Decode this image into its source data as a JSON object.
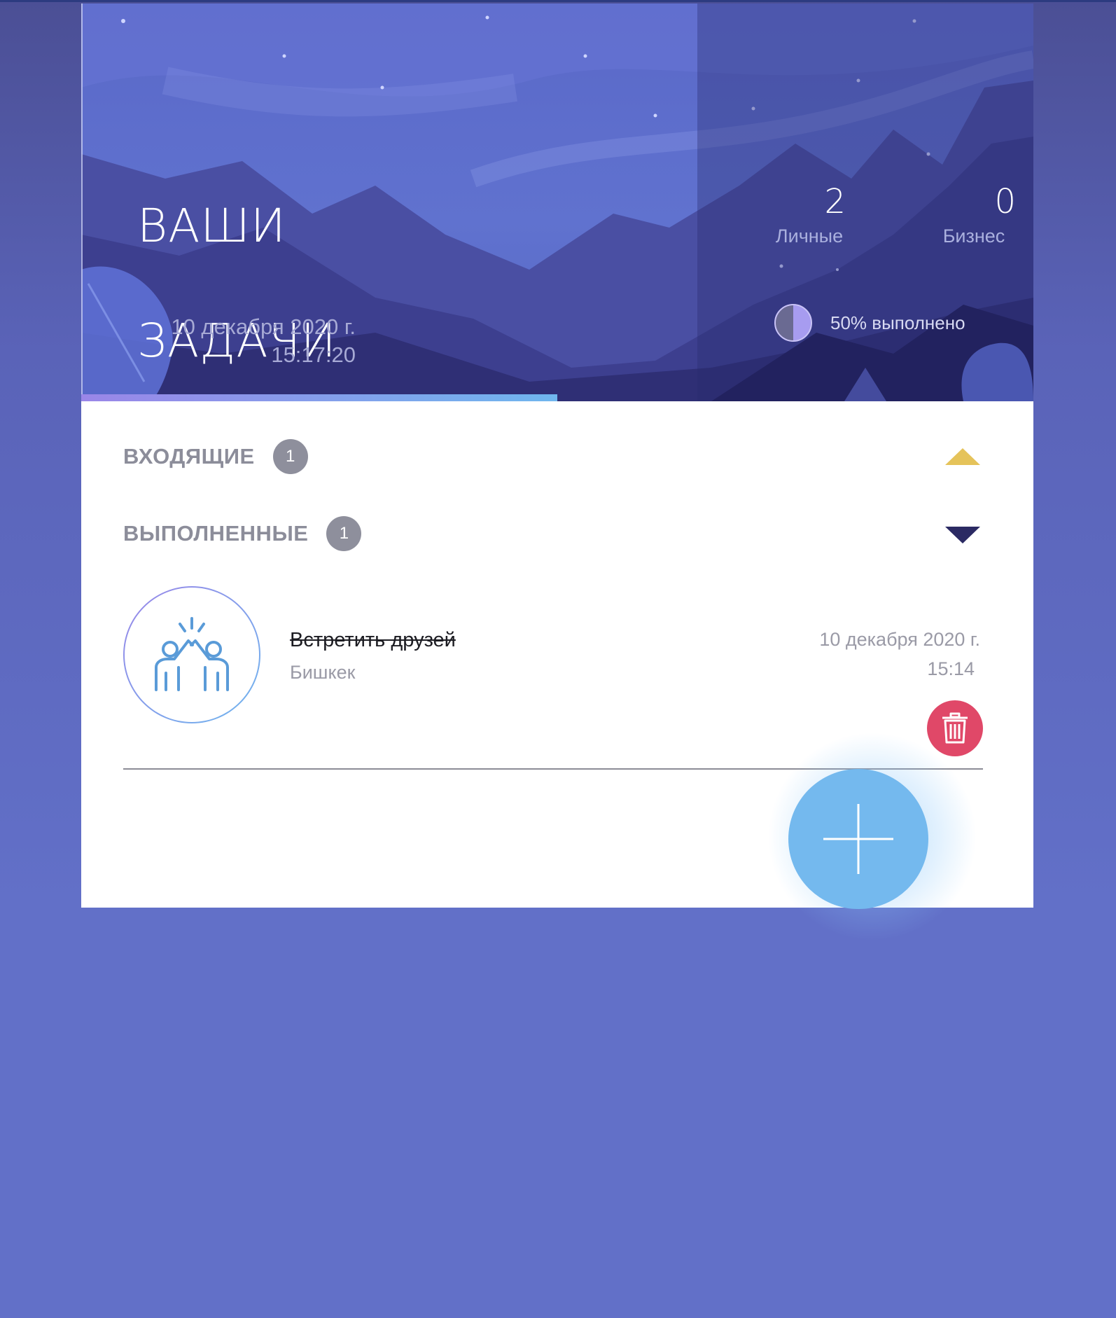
{
  "header": {
    "title_line1": "ВАШИ",
    "title_line2": "ЗАДАЧИ",
    "date": "10 декабря 2020 г.",
    "time": "15:17:20",
    "progress_fraction": 0.5
  },
  "stats": {
    "personal": {
      "value": "2",
      "label": "Личные"
    },
    "business": {
      "value": "0",
      "label": "Бизнес"
    },
    "completion_text": "50% выполнено"
  },
  "sections": {
    "inbox": {
      "label": "ВХОДЯЩИЕ",
      "count": "1",
      "expanded": true
    },
    "completed": {
      "label": "ВЫПОЛНЕННЫЕ",
      "count": "1",
      "expanded": false
    }
  },
  "tasks": [
    {
      "title": "Встретить друзей",
      "place": "Бишкек",
      "date": "10 декабря 2020 г.",
      "time": "15:14",
      "done": true,
      "icon": "friends-high-five-icon"
    }
  ],
  "colors": {
    "accent_up_arrow": "#e5c35a",
    "delete": "#e04868",
    "fab": "#74b9ee"
  }
}
